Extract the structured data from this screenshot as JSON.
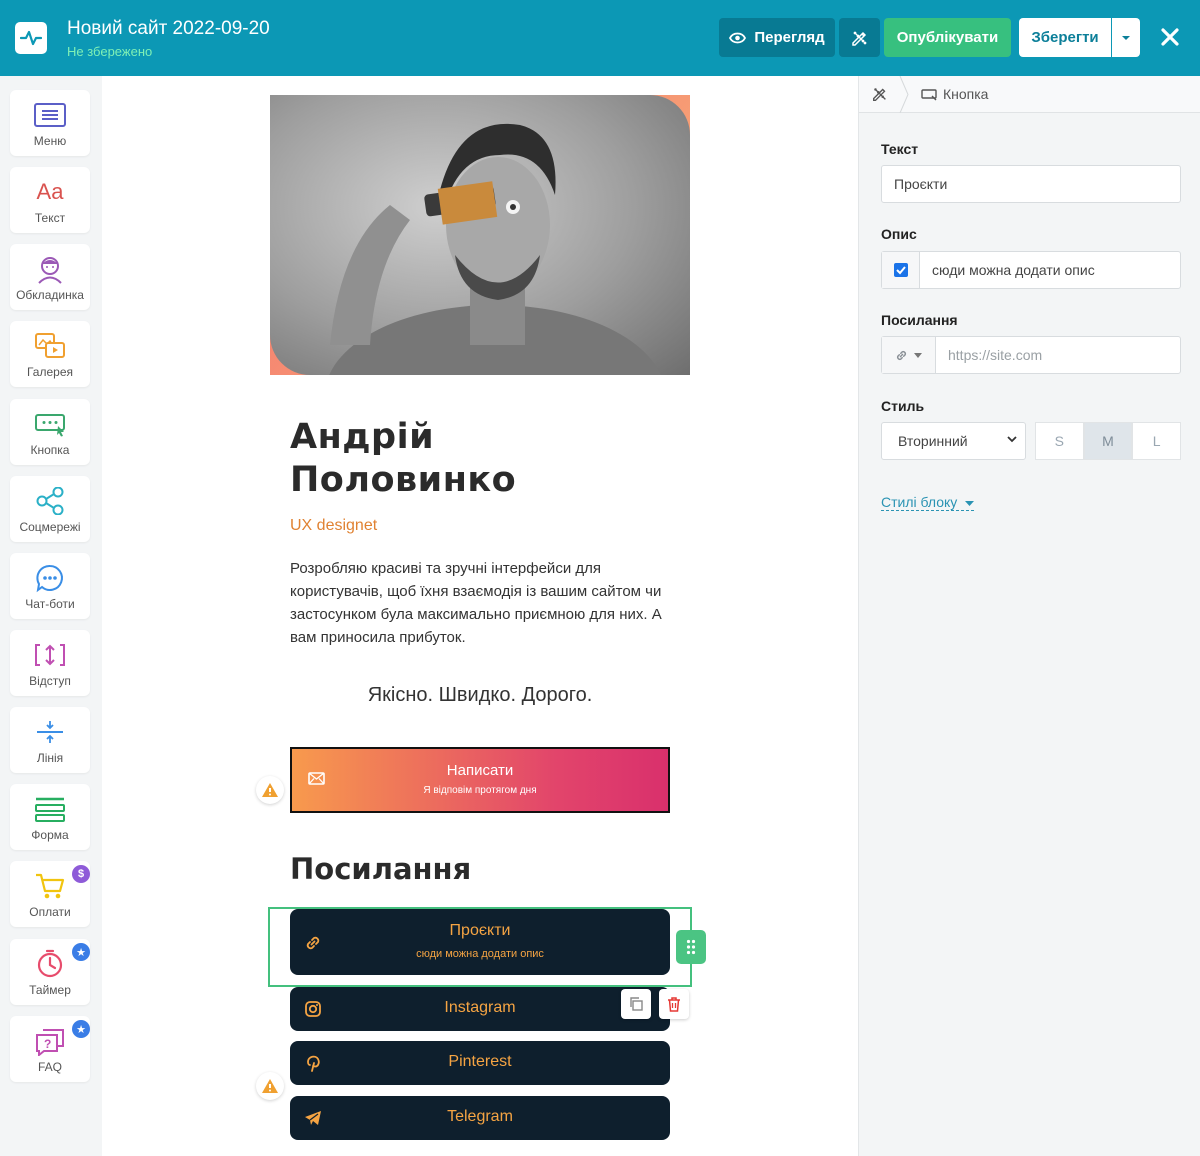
{
  "header": {
    "site_title": "Новий сайт 2022-09-20",
    "status": "Не збережено",
    "preview_label": "Перегляд",
    "publish_label": "Опублікувати",
    "save_label": "Зберегти"
  },
  "sidebar": {
    "items": [
      {
        "label": "Меню",
        "icon": "menu-icon",
        "color": "#5b5fc7"
      },
      {
        "label": "Текст",
        "icon": "text-icon",
        "color": "#d9534f"
      },
      {
        "label": "Обкладинка",
        "icon": "cover-avatar-icon",
        "color": "#9b59b6"
      },
      {
        "label": "Галерея",
        "icon": "gallery-icon",
        "color": "#f0a030"
      },
      {
        "label": "Кнопка",
        "icon": "button-icon",
        "color": "#3aa76d"
      },
      {
        "label": "Соцмережі",
        "icon": "share-icon",
        "color": "#2ab0c7"
      },
      {
        "label": "Чат-боти",
        "icon": "chat-icon",
        "color": "#3a8ee6"
      },
      {
        "label": "Відступ",
        "icon": "spacing-icon",
        "color": "#c04fb2"
      },
      {
        "label": "Лінія",
        "icon": "line-icon",
        "color": "#3a8ee6"
      },
      {
        "label": "Форма",
        "icon": "form-icon",
        "color": "#27ae60"
      },
      {
        "label": "Оплати",
        "icon": "cart-icon",
        "color": "#f1c40f",
        "badge": "$"
      },
      {
        "label": "Таймер",
        "icon": "timer-icon",
        "color": "#e74c6c",
        "badge": "★"
      },
      {
        "label": "FAQ",
        "icon": "faq-icon",
        "color": "#c04fb2",
        "badge": "★"
      }
    ]
  },
  "canvas": {
    "name": "Андрій Половинко",
    "name_line1": "Андрій",
    "name_line2": "Половинко",
    "role": "UX designet",
    "bio": "Розробляю красиві та зручні інтерфейси для користувачів, щоб їхня взаємодія із вашим сайтом чи застосунком була максимально приємною для них. А вам приносила прибуток.",
    "slogan": "Якісно. Швидко. Дорого.",
    "cta": {
      "title": "Написати",
      "subtitle": "Я відповім протягом дня"
    },
    "links_title": "Посилання",
    "links": [
      {
        "title": "Проєкти",
        "subtitle": "сюди можна додати опис",
        "icon": "link-icon"
      },
      {
        "title": "Instagram",
        "icon": "instagram-icon"
      },
      {
        "title": "Pinterest",
        "icon": "pinterest-icon"
      },
      {
        "title": "Telegram",
        "icon": "telegram-icon"
      }
    ]
  },
  "panel": {
    "breadcrumb": "Кнопка",
    "text_label": "Текст",
    "text_value": "Проєкти",
    "desc_label": "Опис",
    "desc_checked": true,
    "desc_value": "сюди можна додати опис",
    "link_label": "Посилання",
    "link_placeholder": "https://site.com",
    "style_label": "Стиль",
    "style_value": "Вторинний",
    "sizes": [
      "S",
      "M",
      "L"
    ],
    "size_selected": "M",
    "block_styles": "Стилі блоку"
  },
  "colors": {
    "header_bg": "#0c98b5",
    "publish_bg": "#37c07f",
    "accent_orange": "#f5a443",
    "dark_button": "#0e1f2d",
    "selection_green": "#44c07e"
  }
}
